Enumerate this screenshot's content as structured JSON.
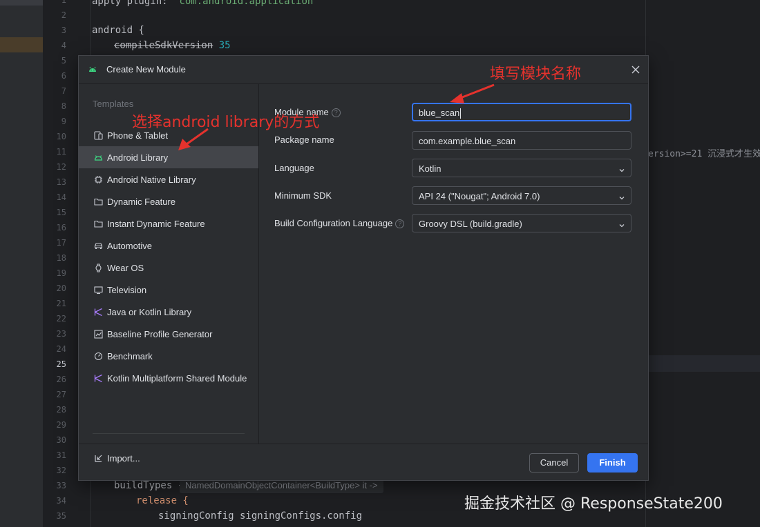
{
  "editor": {
    "line_numbers": [
      "1",
      "2",
      "3",
      "4",
      "5",
      "6",
      "7",
      "8",
      "9",
      "10",
      "11",
      "12",
      "13",
      "14",
      "15",
      "16",
      "17",
      "18",
      "19",
      "20",
      "21",
      "22",
      "23",
      "24",
      "25",
      "26",
      "27",
      "28",
      "29",
      "30",
      "31",
      "32",
      "33",
      "34",
      "35"
    ],
    "code": {
      "line1_a": "apply plugin: ",
      "line1_b": "'com.android.application'",
      "line3": "android {",
      "line4_a": "compileSdkVersion",
      "line4_b": " 35",
      "line33_a": "buildTypes {",
      "line33_hint": "NamedDomainObjectContainer<BuildType> it ->",
      "line34": "release {",
      "line35": "signingConfig signingConfigs.config"
    },
    "side_text": "ersion>=21 沉浸式才生效"
  },
  "dialog": {
    "title": "Create New Module",
    "templates_label": "Templates",
    "templates": [
      {
        "label": "Phone & Tablet",
        "icon": "phone-icon"
      },
      {
        "label": "Android Library",
        "icon": "android-icon"
      },
      {
        "label": "Android Native Library",
        "icon": "chip-icon"
      },
      {
        "label": "Dynamic Feature",
        "icon": "folder-icon"
      },
      {
        "label": "Instant Dynamic Feature",
        "icon": "folder-icon"
      },
      {
        "label": "Automotive",
        "icon": "car-icon"
      },
      {
        "label": "Wear OS",
        "icon": "watch-icon"
      },
      {
        "label": "Television",
        "icon": "tv-icon"
      },
      {
        "label": "Java or Kotlin Library",
        "icon": "kotlin-icon"
      },
      {
        "label": "Baseline Profile Generator",
        "icon": "chart-icon"
      },
      {
        "label": "Benchmark",
        "icon": "gauge-icon"
      },
      {
        "label": "Kotlin Multiplatform Shared Module",
        "icon": "kotlin-icon"
      }
    ],
    "selected_template": "Android Library",
    "import_label": "Import...",
    "form": {
      "module_name_label": "Module name",
      "module_name_value": "blue_scan",
      "package_name_label": "Package name",
      "package_name_value": "com.example.blue_scan",
      "language_label": "Language",
      "language_value": "Kotlin",
      "min_sdk_label": "Minimum SDK",
      "min_sdk_value": "API 24 (\"Nougat\"; Android 7.0)",
      "build_lang_label": "Build Configuration Language",
      "build_lang_value": "Groovy DSL (build.gradle)"
    },
    "cancel_label": "Cancel",
    "finish_label": "Finish"
  },
  "annotations": {
    "module_name_note": "填写模块名称",
    "library_note": "选择android library的方式"
  },
  "watermark": "掘金技术社区 @ ResponseState200",
  "colors": {
    "accent": "#3574f0",
    "annotation": "#e5322d",
    "dialog_bg": "#2b2d30",
    "editor_bg": "#1e1f22"
  }
}
